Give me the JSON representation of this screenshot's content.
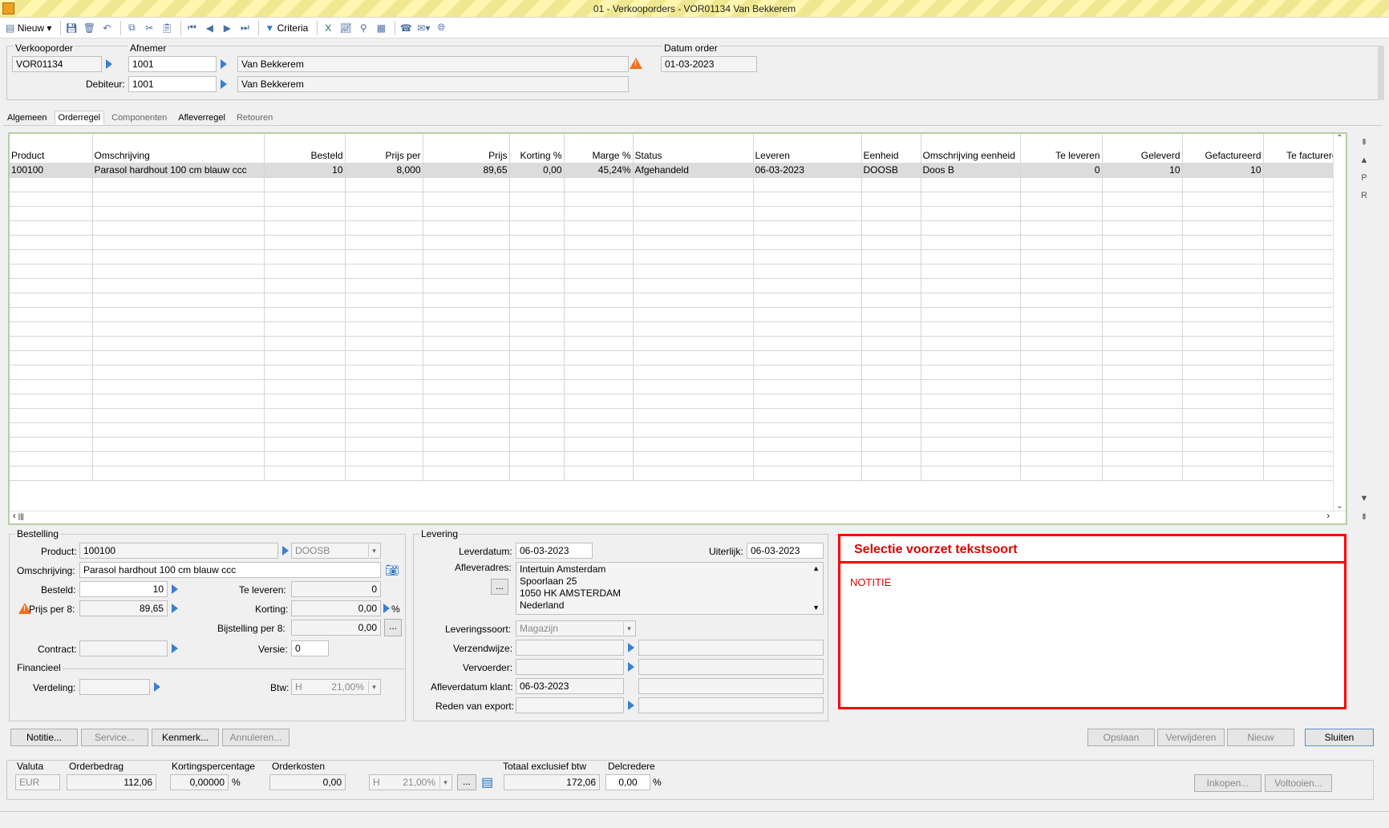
{
  "window": {
    "title": "01 - Verkooporders - VOR01134 Van Bekkerem"
  },
  "toolbar": {
    "new_label": "Nieuw",
    "criteria_label": "Criteria"
  },
  "header": {
    "verkooporder_label": "Verkooporder",
    "verkooporder": "VOR01134",
    "afnemer_label": "Afnemer",
    "afnemer_code": "1001",
    "afnemer_name": "Van Bekkerem",
    "debiteur_label": "Debiteur:",
    "debiteur_code": "1001",
    "debiteur_name": "Van Bekkerem",
    "datum_label": "Datum order",
    "datum": "01-03-2023"
  },
  "tabs": [
    "Algemeen",
    "Orderregel",
    "Componenten",
    "Afleverregel",
    "Retouren"
  ],
  "grid": {
    "columns": [
      "Product",
      "Omschrijving",
      "Besteld",
      "Prijs per",
      "Prijs",
      "Korting %",
      "Marge %",
      "Status",
      "Leveren",
      "Eenheid",
      "Omschrijving eenheid",
      "Te leveren",
      "Geleverd",
      "Gefactureerd",
      "Te facturere"
    ],
    "rows": [
      [
        "100100",
        "Parasol hardhout 100 cm blauw ccc",
        "10",
        "8,000",
        "89,65",
        "0,00",
        "45,24%",
        "Afgehandeld",
        "06-03-2023",
        "DOOSB",
        "Doos B",
        "0",
        "10",
        "10",
        ""
      ]
    ]
  },
  "side_buttons": [
    "⇞",
    "▲",
    "P",
    "R"
  ],
  "bestelling": {
    "title": "Bestelling",
    "product_label": "Product:",
    "product": "100100",
    "unit": "DOOSB",
    "omschrijving_label": "Omschrijving:",
    "omschrijving": "Parasol hardhout 100 cm blauw ccc",
    "besteld_label": "Besteld:",
    "besteld": "10",
    "te_leveren_label": "Te leveren:",
    "te_leveren": "0",
    "prijs_label": "Prijs per 8:",
    "prijs": "89,65",
    "korting_label": "Korting:",
    "korting": "0,00",
    "pct": "%",
    "bijstelling_label": "Bijstelling per 8:",
    "bijstelling": "0,00",
    "contract_label": "Contract:",
    "contract": "",
    "versie_label": "Versie:",
    "versie": "0"
  },
  "financieel": {
    "title": "Financieel",
    "verdeling_label": "Verdeling:",
    "btw_label": "Btw:",
    "btw_code": "H",
    "btw_pct": "21,00%"
  },
  "levering": {
    "title": "Levering",
    "leverdatum_label": "Leverdatum:",
    "leverdatum": "06-03-2023",
    "uiterlijk_label": "Uiterlijk:",
    "uiterlijk": "06-03-2023",
    "afleveradres_label": "Afleveradres:",
    "adres": [
      "Intertuin Amsterdam",
      "Spoorlaan 25",
      "1050 HK  AMSTERDAM",
      "Nederland"
    ],
    "leveringssoort_label": "Leveringssoort:",
    "leveringssoort": "Magazijn",
    "verzendwijze_label": "Verzendwijze:",
    "vervoerder_label": "Vervoerder:",
    "afleverdatum_klant_label": "Afleverdatum klant:",
    "afleverdatum_klant": "06-03-2023",
    "reden_label": "Reden van export:"
  },
  "note": {
    "header": "Selectie voorzet tekstsoort",
    "body": "NOTITIE"
  },
  "buttons": {
    "notitie": "Notitie...",
    "service": "Service...",
    "kenmerk": "Kenmerk...",
    "annuleren": "Annuleren...",
    "opslaan": "Opslaan",
    "verwijderen": "Verwijderen",
    "nieuw": "Nieuw",
    "sluiten": "Sluiten",
    "inkopen": "Inkopen...",
    "voltooien": "Voltooien..."
  },
  "totals": {
    "valuta_label": "Valuta",
    "valuta": "EUR",
    "orderbedrag_label": "Orderbedrag",
    "orderbedrag": "112,06",
    "kortingspct_label": "Kortingspercentage",
    "kortingspct": "0,00000",
    "pct": "%",
    "orderkosten_label": "Orderkosten",
    "orderkosten": "0,00",
    "btw_code": "H",
    "btw_pct": "21,00%",
    "totaal_label": "Totaal exclusief btw",
    "totaal": "172,06",
    "delcredere_label": "Delcredere",
    "delcredere": "0,00"
  },
  "colors": {
    "accent": "#3c7fd0",
    "note_border": "#ff0000",
    "grid_border": "#b7cfa0"
  }
}
